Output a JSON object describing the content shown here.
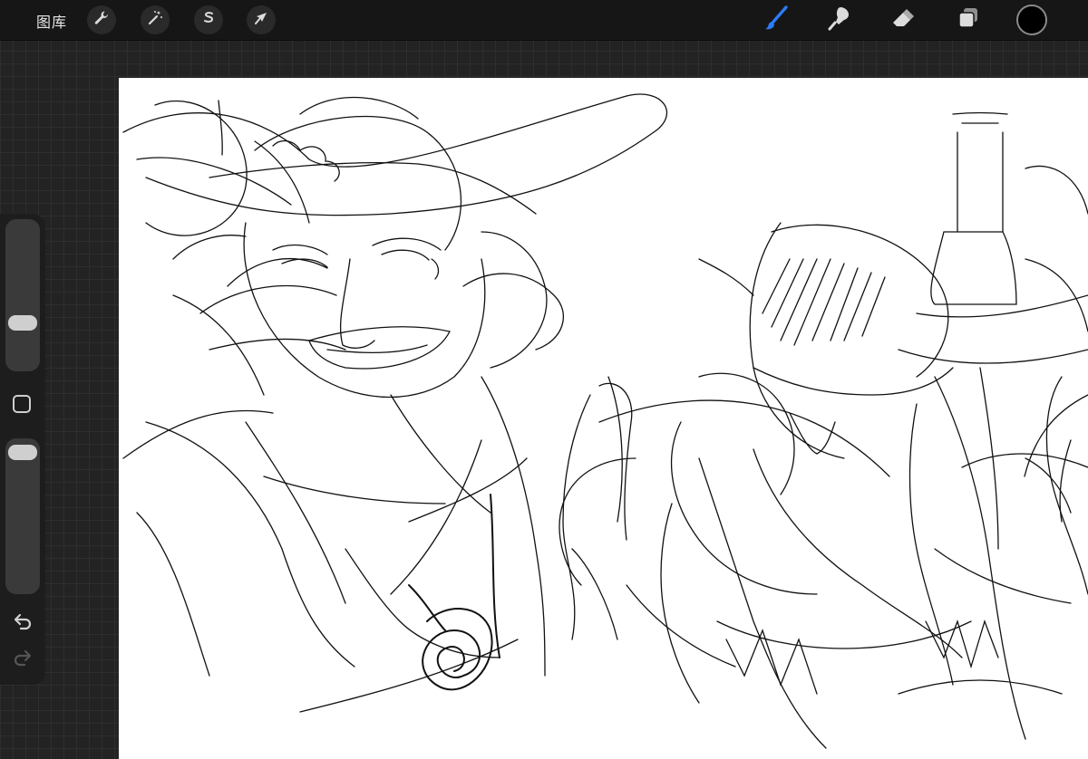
{
  "toolbar": {
    "gallery_label": "图库",
    "left_actions": [
      {
        "name": "actions",
        "icon": "wrench-icon"
      },
      {
        "name": "adjustments",
        "icon": "magic-wand-icon"
      },
      {
        "name": "selection",
        "icon": "selection-s-icon"
      },
      {
        "name": "transform",
        "icon": "arrow-cursor-icon"
      }
    ],
    "right_tools": [
      {
        "name": "brush",
        "icon": "brush-icon",
        "active": true
      },
      {
        "name": "smudge",
        "icon": "smudge-icon",
        "active": false
      },
      {
        "name": "eraser",
        "icon": "eraser-icon",
        "active": false
      },
      {
        "name": "layers",
        "icon": "layers-icon",
        "active": false
      }
    ],
    "current_color": "#000000",
    "accent_color": "#2b7cf6"
  },
  "sidebar": {
    "brush_size_level": 0.29,
    "opacity_level": 0.97,
    "modify_button_icon": "square-icon",
    "undo_icon": "undo-icon",
    "redo_icon": "redo-icon"
  },
  "canvas": {
    "background": "#ffffff",
    "content": "sketch-drawing"
  }
}
